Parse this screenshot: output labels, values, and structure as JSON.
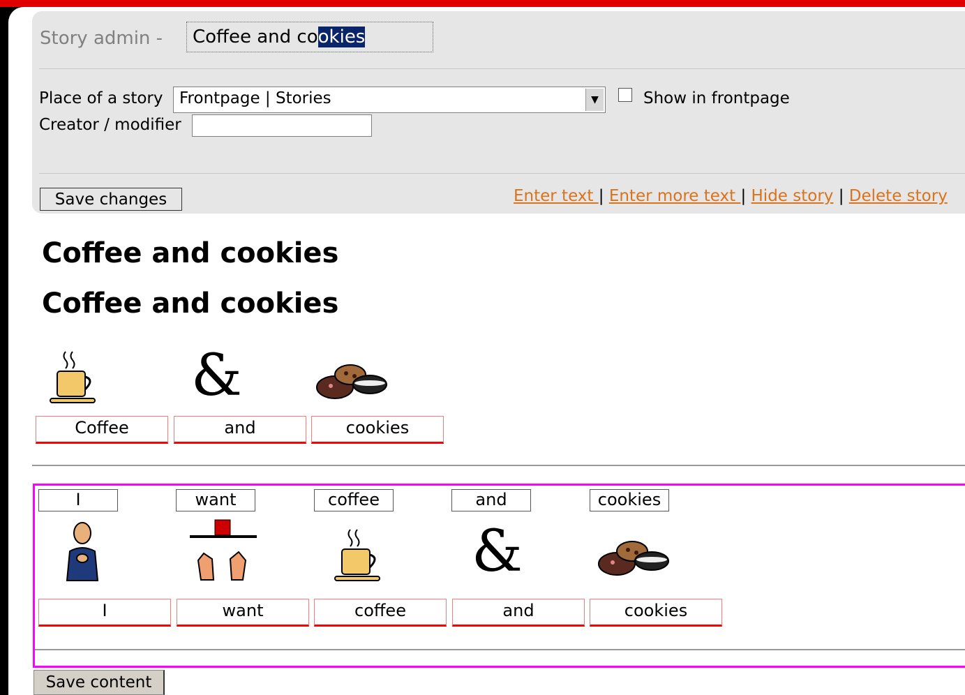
{
  "admin": {
    "label": "Story admin -",
    "title_value_start": "Coffee and co",
    "title_value_selected": "okies",
    "place_label": "Place of a story",
    "place_value": "Frontpage | Stories",
    "show_frontpage_label": "Show in frontpage",
    "show_frontpage_checked": false,
    "creator_label": "Creator / modifier",
    "creator_value": "",
    "save_changes": "Save changes",
    "links": [
      "Enter text ",
      "Enter more text ",
      "Hide story",
      "Delete story"
    ],
    "link_color": "#d9731c"
  },
  "headings": [
    "Coffee and cookies",
    "Coffee and cookies"
  ],
  "symbol_row": {
    "icons": [
      "coffee-cup-icon",
      "ampersand-icon",
      "cookies-icon"
    ],
    "ampersand": "&",
    "words": [
      "Coffee",
      "and",
      "cookies"
    ]
  },
  "edit_row": {
    "labels": [
      "I",
      "want",
      "coffee",
      "and",
      "cookies"
    ],
    "icons": [
      "person-icon",
      "want-hands-icon",
      "coffee-cup-icon",
      "ampersand-icon",
      "cookies-icon"
    ],
    "ampersand": "&",
    "words": [
      "I",
      "want",
      "coffee",
      "and",
      "cookies"
    ],
    "border_color": "#ff00ff"
  },
  "save_content": "Save content",
  "colors": {
    "top_bar": "#e00000",
    "cell_border": "#ff0000",
    "panel": "#e6e6e6"
  }
}
